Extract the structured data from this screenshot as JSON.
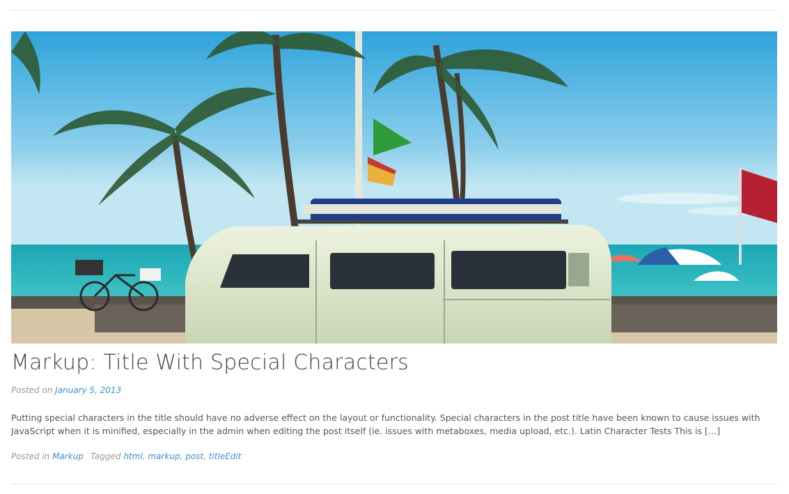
{
  "post": {
    "title": "Markup: Title With Special Characters",
    "posted_on_label": "Posted on",
    "date": "January 5, 2013",
    "excerpt": "Putting special characters in the title should have no adverse effect on the layout or functionality. Special characters in the post title have been known to cause issues with JavaScript when it is minified, especially in the admin when editing the post itself (ie. issues with metaboxes, media upload, etc.). Latin Character Tests This is […]",
    "posted_in_label": "Posted in",
    "category": "Markup",
    "tagged_label": "Tagged",
    "tags": [
      "html",
      "markup",
      "post",
      "title"
    ],
    "tag_separator": ", ",
    "edit_label": "Edit"
  },
  "featured_image": {
    "alt_icon": "beach-van-photo"
  },
  "colors": {
    "link": "#3f8fd2",
    "title": "#444444",
    "meta": "#999999",
    "body_text": "#555555"
  }
}
